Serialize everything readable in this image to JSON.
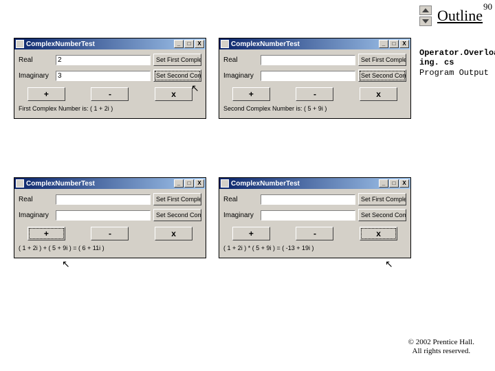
{
  "page_number": "90",
  "outline_label": "Outline",
  "info": {
    "line1": "Operator.Overload",
    "line2": "ing. cs",
    "line3": "Program Output"
  },
  "footer": {
    "line1": "© 2002 Prentice Hall.",
    "line2": "All rights reserved."
  },
  "common": {
    "window_title": "ComplexNumberTest",
    "label_real": "Real",
    "label_imag": "Imaginary",
    "btn_set_first": "Set First Complex Number",
    "btn_set_second": "Set Second Complex Number",
    "op_plus": "+",
    "op_minus": "-",
    "op_mult": "x",
    "win_min": "_",
    "win_max": "□",
    "win_close": "X"
  },
  "windows": [
    {
      "real_value": "2",
      "imag_value": "3",
      "focus_btn": "second",
      "status": "First Complex Number is: ( 1 + 2i )",
      "focus_op": null
    },
    {
      "real_value": "",
      "imag_value": "",
      "focus_btn": "second",
      "status": "Second Complex Number is: ( 5 + 9i )",
      "focus_op": null
    },
    {
      "real_value": "",
      "imag_value": "",
      "focus_btn": null,
      "status": "( 1 + 2i ) + ( 5 + 9i ) = ( 6 + 11i )",
      "focus_op": "plus"
    },
    {
      "real_value": "",
      "imag_value": "",
      "focus_btn": null,
      "status": "( 1 + 2i ) * ( 5 + 9i ) = ( -13 + 19i )",
      "focus_op": "mult"
    }
  ]
}
